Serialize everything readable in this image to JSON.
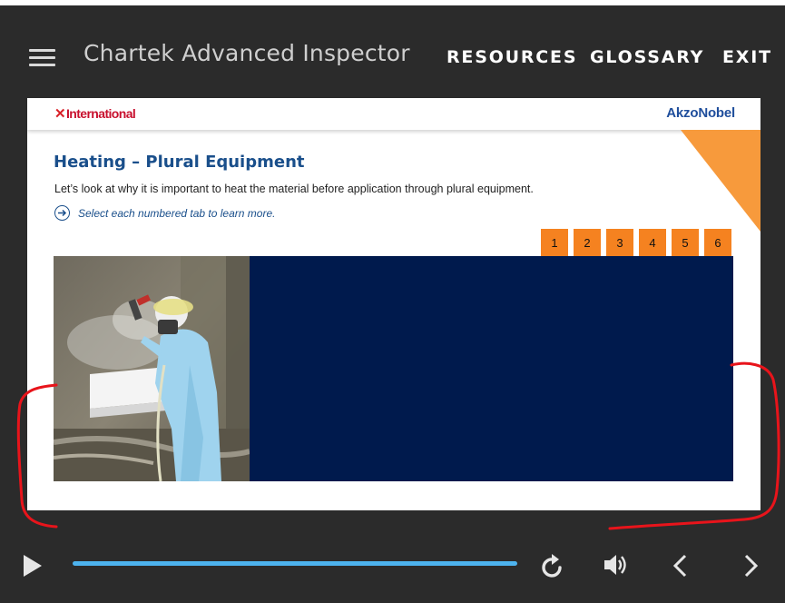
{
  "header": {
    "app_title": "Chartek Advanced Inspector",
    "nav": {
      "resources": "RESOURCES",
      "glossary": "GLOSSARY",
      "exit": "EXIT"
    }
  },
  "slide": {
    "logo_left": "International",
    "logo_right": "AkzoNobel",
    "title": "Heating – Plural Equipment",
    "description": "Let’s look at why it is important to heat the material before application through plural equipment.",
    "instruction": "Select each numbered tab to learn more.",
    "tabs": [
      "1",
      "2",
      "3",
      "4",
      "5",
      "6"
    ]
  },
  "controls": {
    "icons": [
      "play-icon",
      "replay-icon",
      "volume-icon",
      "previous-icon",
      "next-icon"
    ],
    "progress": 1.0
  },
  "colors": {
    "player_bg": "#2b2b2b",
    "tab_orange": "#f58220",
    "panel_navy": "#001a4d",
    "title_blue": "#1a4f8b",
    "progress_blue": "#4db3ee",
    "annotation_red": "#e8141b",
    "corner_orange": "#f79a3c"
  }
}
